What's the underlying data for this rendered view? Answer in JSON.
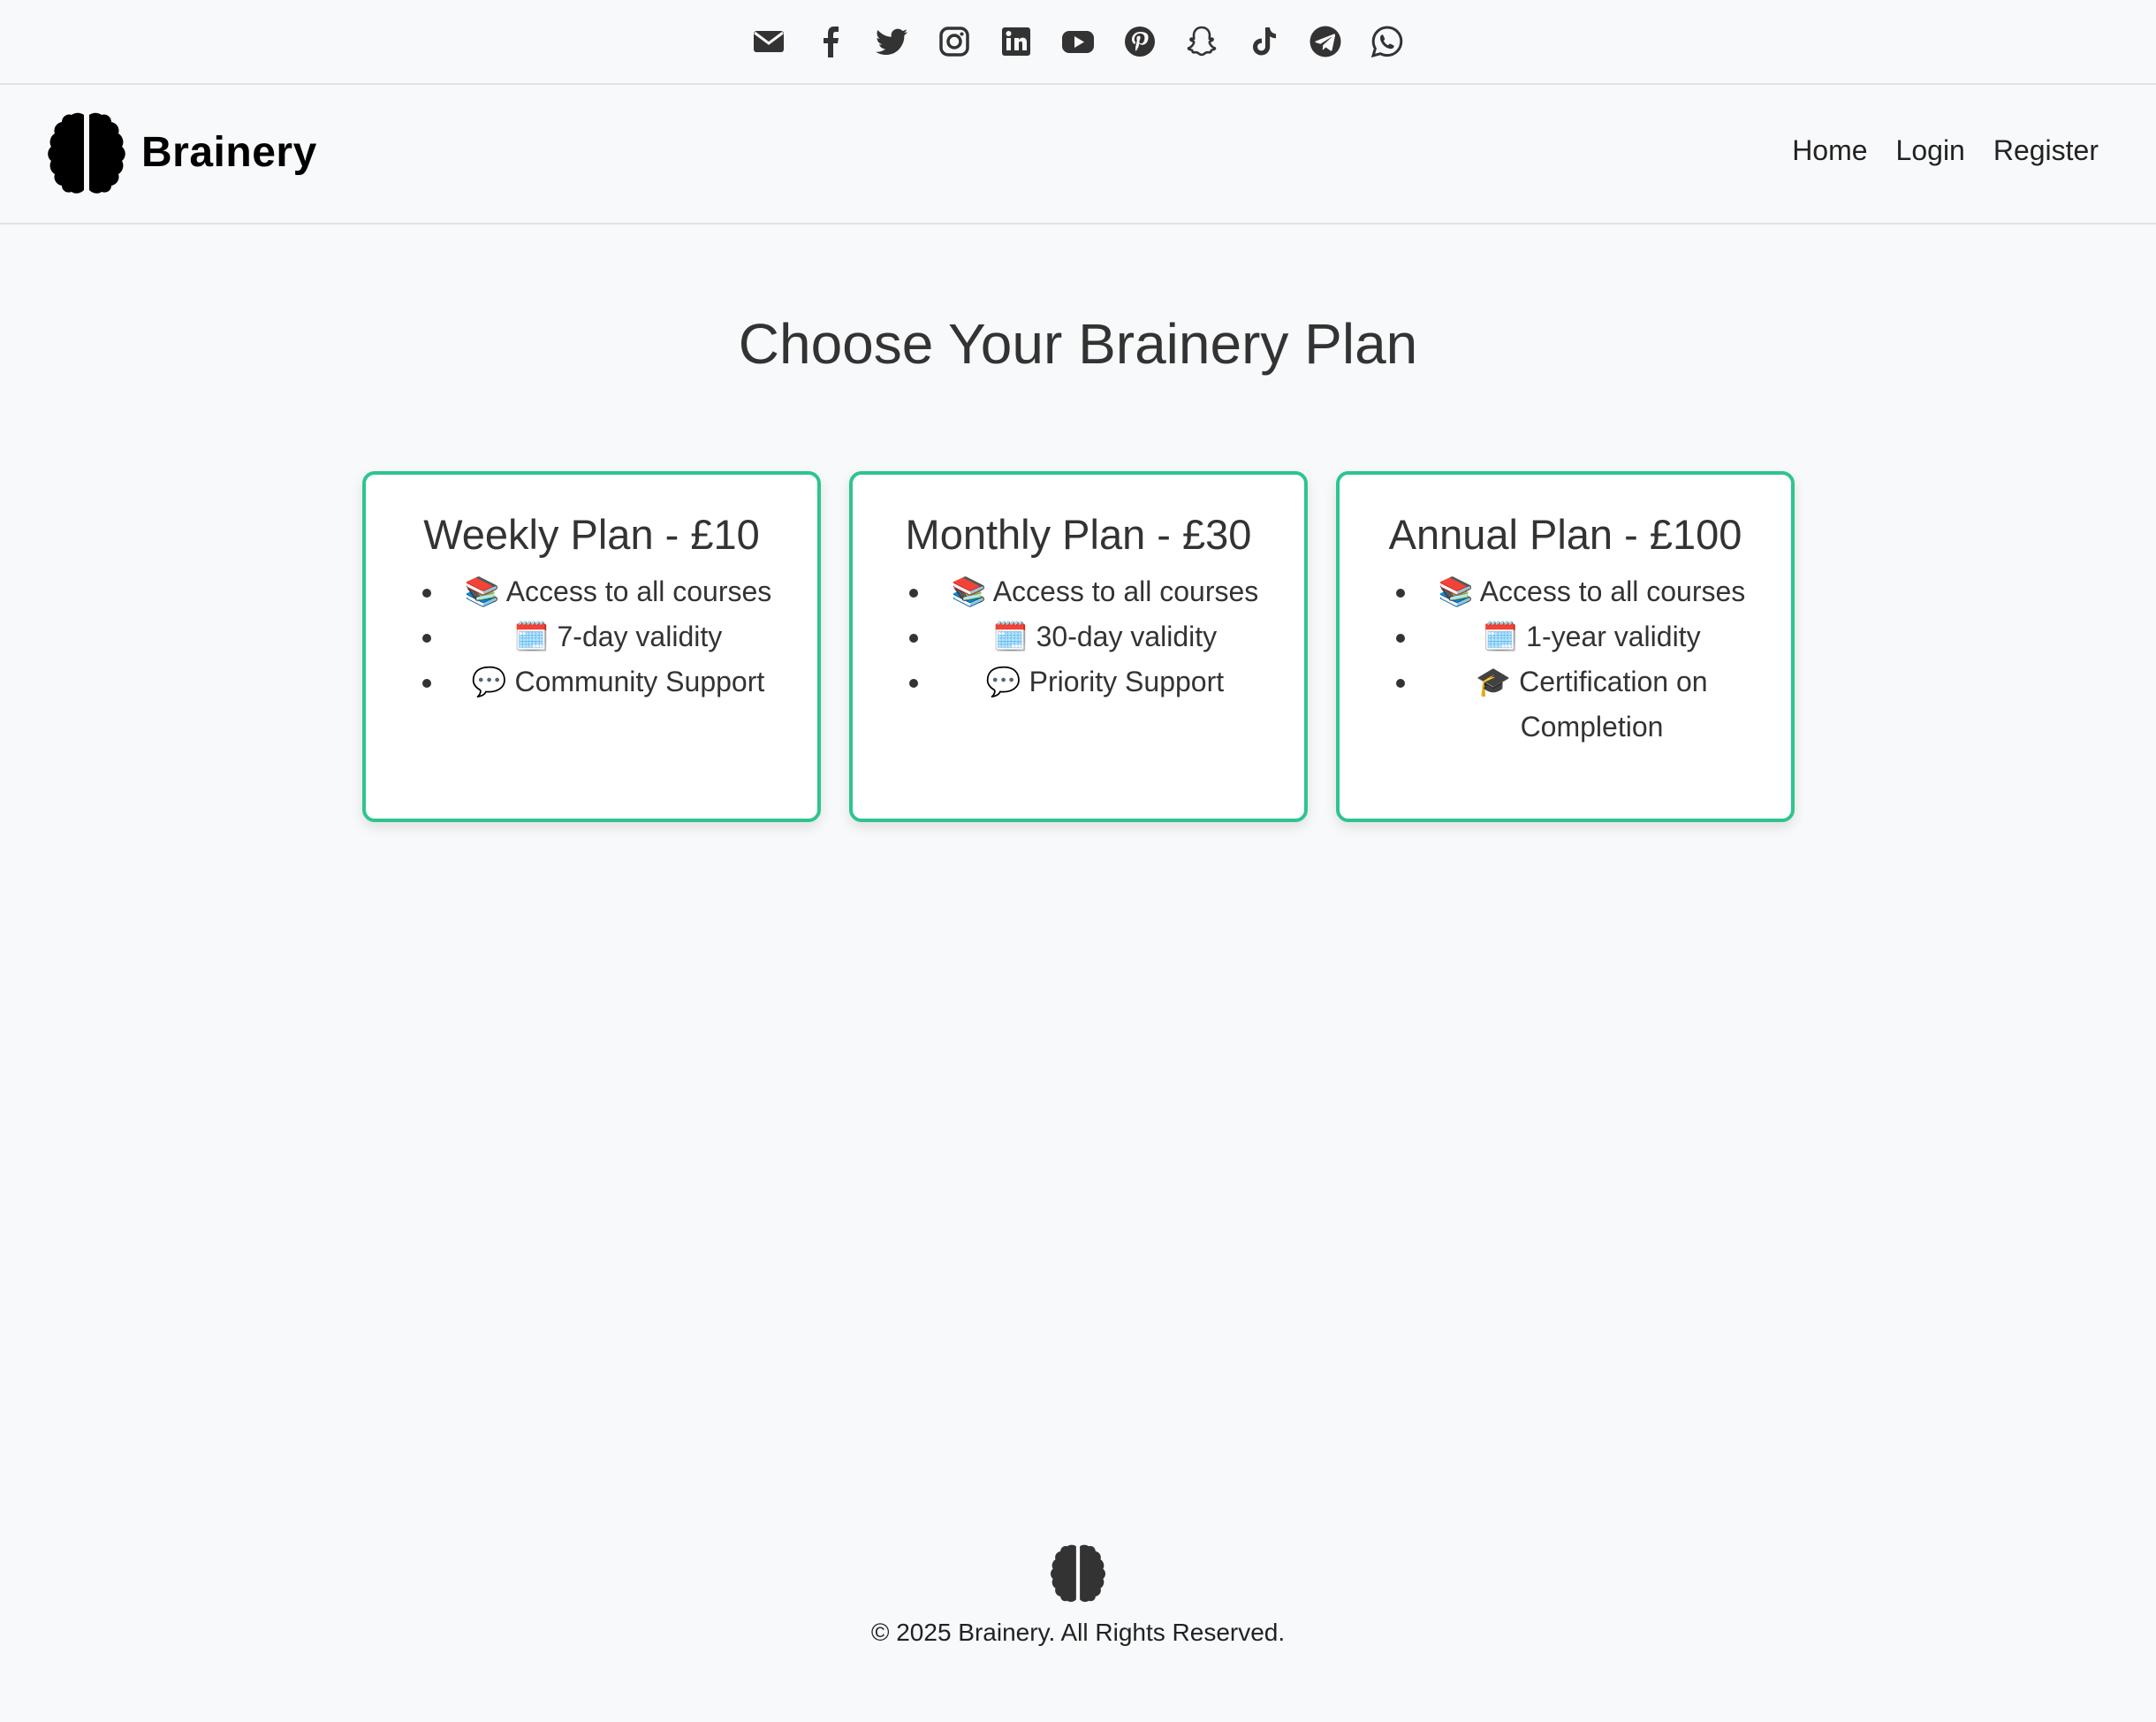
{
  "social": {
    "icons": [
      "envelope-icon",
      "facebook-icon",
      "twitter-icon",
      "instagram-icon",
      "linkedin-icon",
      "youtube-icon",
      "pinterest-icon",
      "snapchat-icon",
      "tiktok-icon",
      "telegram-icon",
      "whatsapp-icon"
    ]
  },
  "header": {
    "brand": "Brainery",
    "nav": {
      "home": "Home",
      "login": "Login",
      "register": "Register"
    }
  },
  "main": {
    "title": "Choose Your Brainery Plan",
    "plans": [
      {
        "title": "Weekly Plan - £10",
        "features": [
          "📚 Access to all courses",
          "🗓️ 7-day validity",
          "💬 Community Support"
        ]
      },
      {
        "title": "Monthly Plan - £30",
        "features": [
          "📚 Access to all courses",
          "🗓️ 30-day validity",
          "💬 Priority Support"
        ]
      },
      {
        "title": "Annual Plan - £100",
        "features": [
          "📚 Access to all courses",
          "🗓️ 1-year validity",
          "🎓 Certification on Completion"
        ]
      }
    ]
  },
  "footer": {
    "copyright": "© 2025 Brainery. All Rights Reserved."
  },
  "colors": {
    "accent_border": "#2ec48f",
    "background": "#f8f9fa",
    "text": "#333333"
  }
}
